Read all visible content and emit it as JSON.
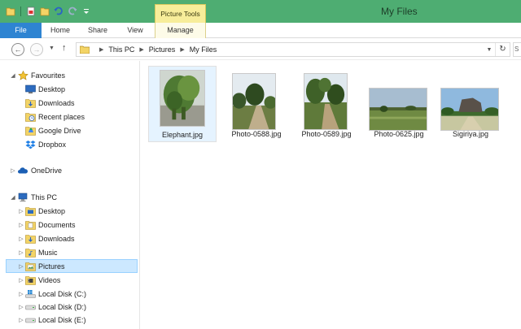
{
  "titlebar": {
    "contextual_tab": "Picture Tools",
    "title": "My Files"
  },
  "ribbon": {
    "tabs": [
      {
        "label": "File"
      },
      {
        "label": "Home"
      },
      {
        "label": "Share"
      },
      {
        "label": "View"
      },
      {
        "label": "Manage"
      }
    ]
  },
  "address": {
    "segments": [
      "This PC",
      "Pictures",
      "My Files"
    ]
  },
  "navpane": {
    "favourites": {
      "label": "Favourites",
      "items": [
        {
          "label": "Desktop",
          "icon": "desktop-icon"
        },
        {
          "label": "Downloads",
          "icon": "downloads-folder-icon"
        },
        {
          "label": "Recent places",
          "icon": "recent-places-icon"
        },
        {
          "label": "Google Drive",
          "icon": "google-drive-icon"
        },
        {
          "label": "Dropbox",
          "icon": "dropbox-icon"
        }
      ]
    },
    "onedrive": {
      "label": "OneDrive"
    },
    "thispc": {
      "label": "This PC",
      "items": [
        {
          "label": "Desktop",
          "icon": "desktop-folder-icon"
        },
        {
          "label": "Documents",
          "icon": "documents-folder-icon"
        },
        {
          "label": "Downloads",
          "icon": "downloads-folder-icon"
        },
        {
          "label": "Music",
          "icon": "music-folder-icon"
        },
        {
          "label": "Pictures",
          "icon": "pictures-folder-icon",
          "selected": true
        },
        {
          "label": "Videos",
          "icon": "videos-folder-icon"
        },
        {
          "label": "Local Disk (C:)",
          "icon": "system-drive-icon"
        },
        {
          "label": "Local Disk (D:)",
          "icon": "drive-icon"
        },
        {
          "label": "Local Disk (E:)",
          "icon": "drive-icon"
        }
      ]
    }
  },
  "files": [
    {
      "name": "Elephant.jpg",
      "selected": true
    },
    {
      "name": "Photo-0588.jpg",
      "selected": false
    },
    {
      "name": "Photo-0589.jpg",
      "selected": false
    },
    {
      "name": "Photo-0625.jpg",
      "selected": false
    },
    {
      "name": "Sigiriya.jpg",
      "selected": false
    }
  ],
  "colors": {
    "titlebar": "#4ead72",
    "file_tab": "#2e84d2",
    "contextual_tab": "#f7ed9a",
    "selection": "#cce8ff"
  }
}
